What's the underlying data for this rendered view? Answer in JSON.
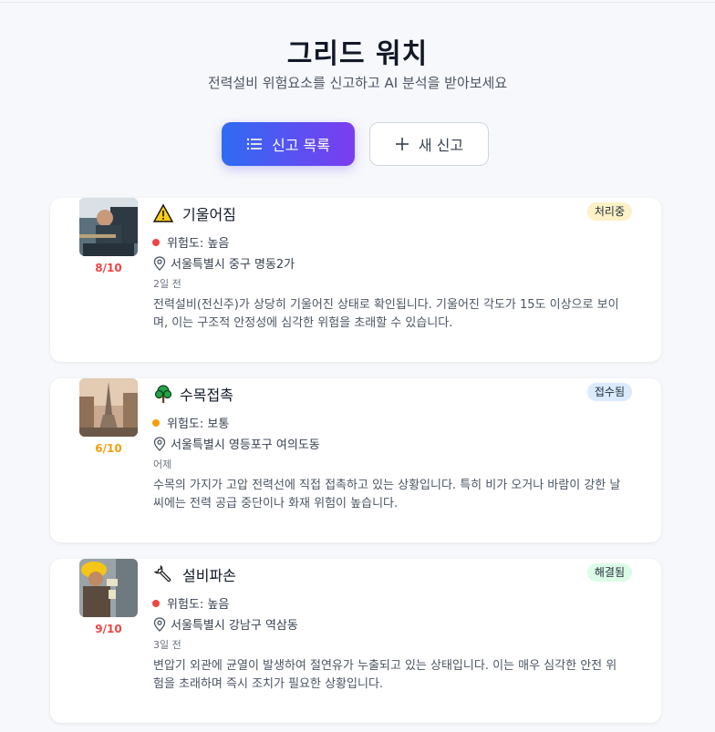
{
  "header": {
    "title": "그리드 워치",
    "subtitle": "전력설비 위험요소를 신고하고 AI 분석을 받아보세요"
  },
  "actions": {
    "list_label": "신고 목록",
    "new_label": "새 신고"
  },
  "colors": {
    "high": "#ef4444",
    "medium": "#f59e0b",
    "accent_start": "#2f6bf3",
    "accent_end": "#7b3df0"
  },
  "reports": [
    {
      "category": "기울어짐",
      "icon": "warning-icon",
      "status": "처리중",
      "risk": "위험도: 높음",
      "location": "서울특별시 중구 명동2가",
      "time": "2일 전",
      "score": "8/10",
      "description": "전력설비(전신주)가 상당히 기울어진 상태로 확인됩니다. 기울어진 각도가 15도 이상으로 보이며, 이는 구조적 안정성에 심각한 위험을 초래할 수 있습니다."
    },
    {
      "category": "수목접촉",
      "icon": "tree-icon",
      "status": "접수됨",
      "risk": "위험도: 보통",
      "location": "서울특별시 영등포구 여의도동",
      "time": "어제",
      "score": "6/10",
      "description": "수목의 가지가 고압 전력선에 직접 접촉하고 있는 상황입니다. 특히 비가 오거나 바람이 강한 날씨에는 전력 공급 중단이나 화재 위험이 높습니다."
    },
    {
      "category": "설비파손",
      "icon": "wrench-icon",
      "status": "해결됨",
      "risk": "위험도: 높음",
      "location": "서울특별시 강남구 역삼동",
      "time": "3일 전",
      "score": "9/10",
      "description": "변압기 외관에 균열이 발생하여 절연유가 누출되고 있는 상태입니다. 이는 매우 심각한 안전 위험을 초래하며 즉시 조치가 필요한 상황입니다."
    }
  ]
}
